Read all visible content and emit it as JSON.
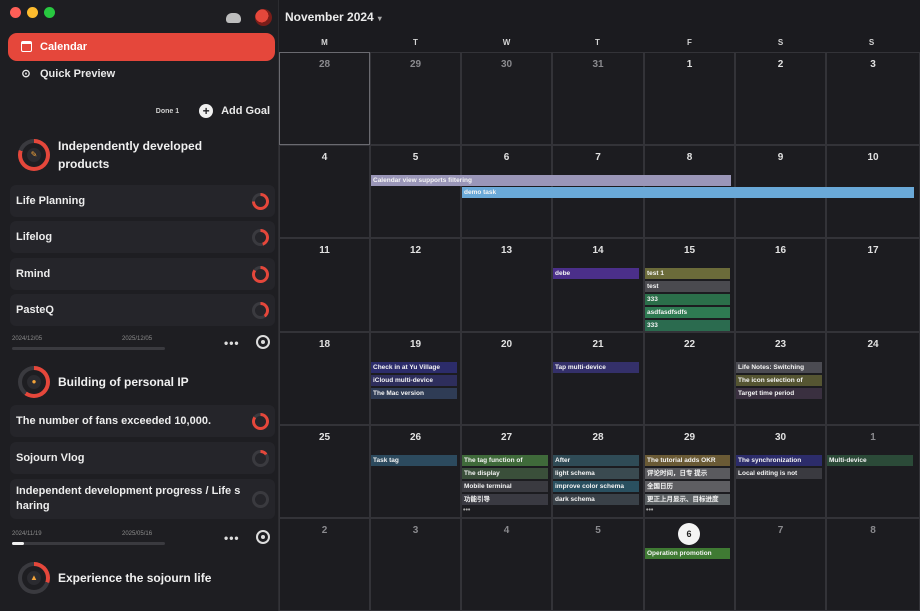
{
  "sidebar": {
    "nav": [
      {
        "label": "Calendar",
        "icon": "calendar-icon",
        "active": true
      },
      {
        "label": "Quick Preview",
        "icon": "quick-preview-icon",
        "active": false
      }
    ],
    "done_label": "Done 1",
    "add_goal_label": "Add Goal",
    "goals": [
      {
        "title_line1": "Independently developed",
        "title_line2": "products",
        "tasks": [
          "Life Planning",
          "Lifelog",
          "Rmind",
          "PasteQ"
        ],
        "start_date": "2024/12/05",
        "end_date": "2025/12/05",
        "progress": 0
      },
      {
        "title_line1": "Building of personal IP",
        "tasks": [
          "The number of fans exceeded 10,000.",
          "Sojourn Vlog"
        ],
        "task_multiline": {
          "line1": "Independent development progress / Life s",
          "line2": "haring"
        },
        "start_date": "2024/11/19",
        "end_date": "2025/05/16",
        "progress": 8
      },
      {
        "title_line1": "Experience the sojourn life"
      }
    ]
  },
  "header": {
    "month_title": "November 2024",
    "chevron": "▾"
  },
  "calendar": {
    "weekdays": [
      "M",
      "T",
      "W",
      "T",
      "F",
      "S",
      "S"
    ],
    "weeks": [
      [
        "28",
        "29",
        "30",
        "31",
        "1",
        "2",
        "3"
      ],
      [
        "4",
        "5",
        "6",
        "7",
        "8",
        "9",
        "10"
      ],
      [
        "11",
        "12",
        "13",
        "14",
        "15",
        "16",
        "17"
      ],
      [
        "18",
        "19",
        "20",
        "21",
        "22",
        "23",
        "24"
      ],
      [
        "25",
        "26",
        "27",
        "28",
        "29",
        "30",
        "1"
      ],
      [
        "2",
        "3",
        "4",
        "5",
        "6",
        "7",
        "8"
      ]
    ],
    "today": "6",
    "events": {
      "e1": "Calendar view supports filtering",
      "e2": "demo task",
      "e3": "debe",
      "e4": "test 1",
      "e5": "test",
      "e6": "333",
      "e7": "asdfasdfsdfs",
      "e8": "333",
      "e9": "Check in at Yu Village",
      "e10": "iCloud multi-device",
      "e11": "The Mac version",
      "e12": "Tap multi-device",
      "e13": "Life Notes: Switching",
      "e14": "The icon selection of",
      "e15": "Target time period",
      "e16": "Task tag",
      "e17": "The tag function of",
      "e18": "The display",
      "e19": "Mobile terminal",
      "e20": "功能引导",
      "e21": "After",
      "e22": "light schema",
      "e23": "improve color schema",
      "e24": "dark schema",
      "e25": "The tutorial adds OKR",
      "e26": "评论时间，日专 提示",
      "e27": "全国日历",
      "e28": "更正上月显示、目标进度",
      "e29": "The synchronization",
      "e30": "Local editing is not",
      "e31": "Multi-device",
      "e32": "Operation promotion"
    },
    "more": "•••"
  }
}
